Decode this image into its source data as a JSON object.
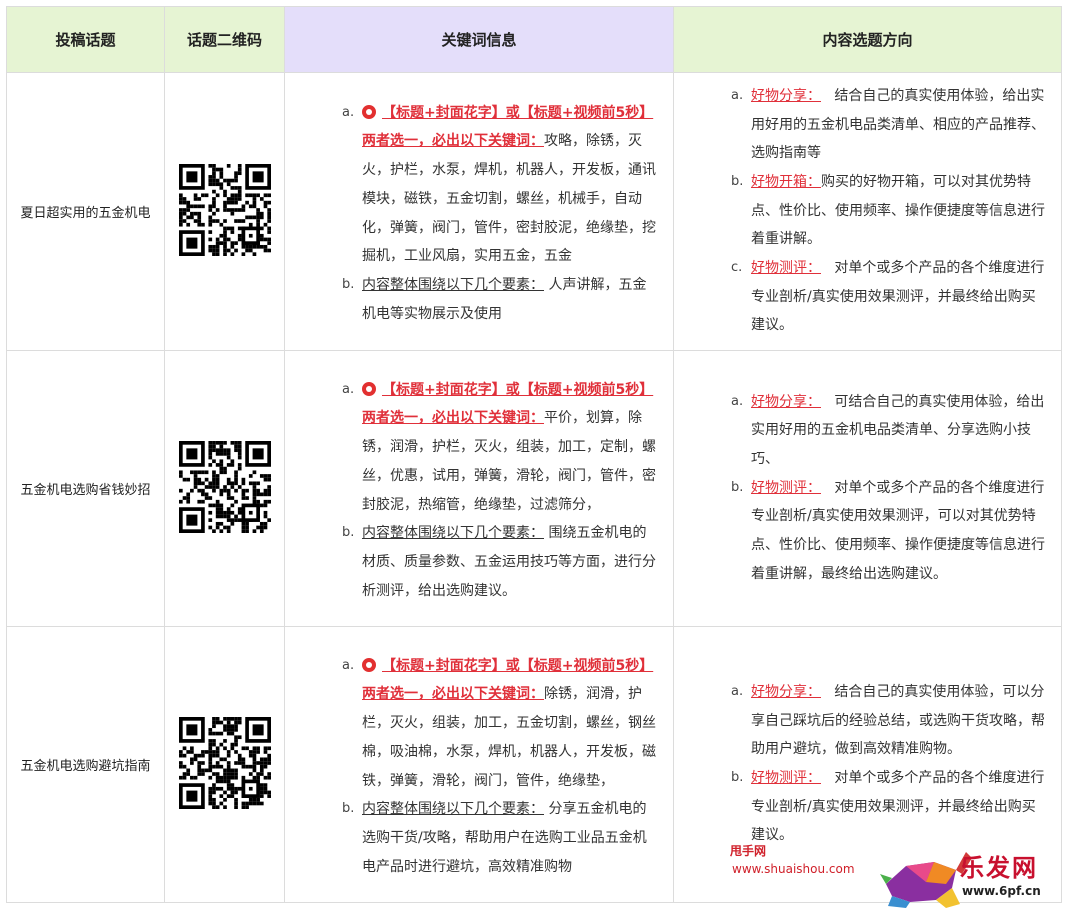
{
  "headers": {
    "topic": "投稿话题",
    "qr": "话题二维码",
    "keywords": "关键词信息",
    "direction": "内容选题方向"
  },
  "rows": [
    {
      "topic": "夏日超实用的五金机电",
      "kw_a_marker": "a.",
      "kw_a_bold": "【标题+封面花字】或【标题+视频前5秒】两者选一，必出以下关键词：",
      "kw_a_text": "攻略，除锈，灭火，护栏，水泵，焊机，机器人，开发板，通讯模块，磁铁，五金切割，螺丝，机械手，自动化，弹簧，阀门，管件，密封胶泥，绝缘垫，挖掘机，工业风扇，实用五金，五金",
      "kw_b_marker": "b.",
      "kw_b_label": "内容整体围绕以下几个要素：",
      "kw_b_text": "人声讲解，五金机电等实物展示及使用",
      "dir": [
        {
          "marker": "a.",
          "label": "好物分享：",
          "text": "结合自己的真实使用体验，给出实用好用的五金机电品类清单、相应的产品推荐、选购指南等"
        },
        {
          "marker": "b.",
          "label": "好物开箱：",
          "text": "购买的好物开箱，可以对其优势特点、性价比、使用频率、操作便捷度等信息进行着重讲解。"
        },
        {
          "marker": "c.",
          "label": "好物测评：",
          "text": "对单个或多个产品的各个维度进行专业剖析/真实使用效果测评，并最终给出购买建议。"
        }
      ]
    },
    {
      "topic": "五金机电选购省钱妙招",
      "kw_a_marker": "a.",
      "kw_a_bold": "【标题+封面花字】或【标题+视频前5秒】两者选一，必出以下关键词：",
      "kw_a_text": "平价，划算，除锈，润滑，护栏，灭火，组装，加工，定制，螺丝，优惠，试用，弹簧，滑轮，阀门，管件，密封胶泥，热缩管，绝缘垫，过滤筛分，",
      "kw_b_marker": "b.",
      "kw_b_label": "内容整体围绕以下几个要素：",
      "kw_b_text": "围绕五金机电的材质、质量参数、五金运用技巧等方面，进行分析测评，给出选购建议。",
      "dir": [
        {
          "marker": "a.",
          "label": "好物分享：",
          "text": "可结合自己的真实使用体验，给出实用好用的五金机电品类清单、分享选购小技巧、"
        },
        {
          "marker": "b.",
          "label": "好物测评：",
          "text": "对单个或多个产品的各个维度进行专业剖析/真实使用效果测评，可以对其优势特点、性价比、使用频率、操作便捷度等信息进行着重讲解，最终给出选购建议。"
        }
      ]
    },
    {
      "topic": "五金机电选购避坑指南",
      "kw_a_marker": "a.",
      "kw_a_bold": "【标题+封面花字】或【标题+视频前5秒】两者选一，必出以下关键词：",
      "kw_a_text": "除锈，润滑，护栏，灭火，组装，加工，五金切割，螺丝，钢丝棉，吸油棉，水泵，焊机，机器人，开发板，磁铁，弹簧，滑轮，阀门，管件，绝缘垫，",
      "kw_b_marker": "b.",
      "kw_b_label": "内容整体围绕以下几个要素：",
      "kw_b_text": "分享五金机电的选购干货/攻略，帮助用户在选购工业品五金机电产品时进行避坑，高效精准购物",
      "dir": [
        {
          "marker": "a.",
          "label": "好物分享：",
          "text": "结合自己的真实使用体验，可以分享自己踩坑后的经验总结，或选购干货攻略，帮助用户避坑，做到高效精准购物。"
        },
        {
          "marker": "b.",
          "label": "好物测评：",
          "text": "对单个或多个产品的各个维度进行专业剖析/真实使用效果测评，并最终给出购买建议。"
        }
      ]
    }
  ],
  "watermark": {
    "site_name": "甩手网",
    "site_url": "www.shuaishou.com",
    "logo_text": "乐发网",
    "logo_url": "www.6pf.cn"
  },
  "colors": {
    "header_green": "#e6f4d3",
    "header_purple": "#e4defa",
    "accent_red": "#e0303a"
  }
}
